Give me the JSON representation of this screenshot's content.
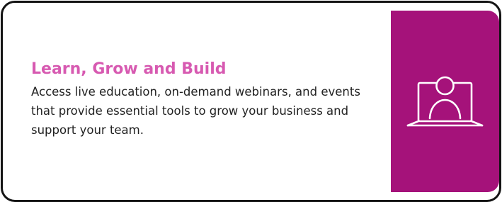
{
  "card": {
    "title": "Learn, Grow and Build",
    "description": "Access live education, on-demand webinars, and events that provide essential tools to grow your business and support your team.",
    "icon": "laptop-user-icon"
  },
  "colors": {
    "title": "#d75ab1",
    "panel": "#a5127a",
    "border": "#141414",
    "text": "#222222"
  }
}
